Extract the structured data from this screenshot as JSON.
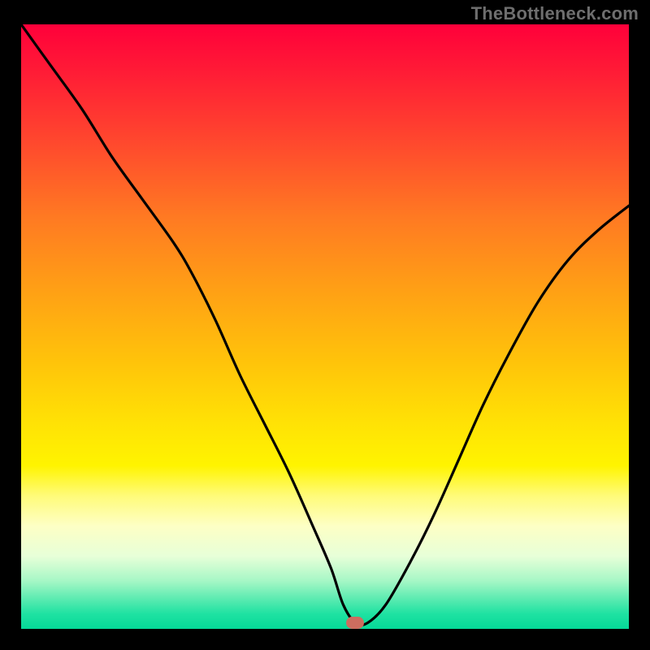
{
  "watermark": "TheBottleneck.com",
  "colors": {
    "background": "#000000",
    "curve": "#000000",
    "marker": "#cd6d5f",
    "gradient_top": "#ff003a",
    "gradient_mid": "#ffe205",
    "gradient_bottom": "#05d998"
  },
  "chart_data": {
    "type": "line",
    "title": "",
    "xlabel": "",
    "ylabel": "",
    "ylim": [
      0,
      100
    ],
    "xlim": [
      0,
      100
    ],
    "grid": false,
    "legend": false,
    "marker_position": {
      "x": 55,
      "y": 1
    },
    "series": [
      {
        "name": "bottleneck",
        "x": [
          0,
          5,
          10,
          15,
          20,
          25,
          28,
          32,
          36,
          40,
          44,
          48,
          51,
          53,
          55,
          57,
          60,
          64,
          68,
          72,
          76,
          80,
          85,
          90,
          95,
          100
        ],
        "y": [
          100,
          93,
          86,
          78,
          71,
          64,
          59,
          51,
          42,
          34,
          26,
          17,
          10,
          4,
          1,
          1,
          4,
          11,
          19,
          28,
          37,
          45,
          54,
          61,
          66,
          70
        ]
      }
    ]
  }
}
